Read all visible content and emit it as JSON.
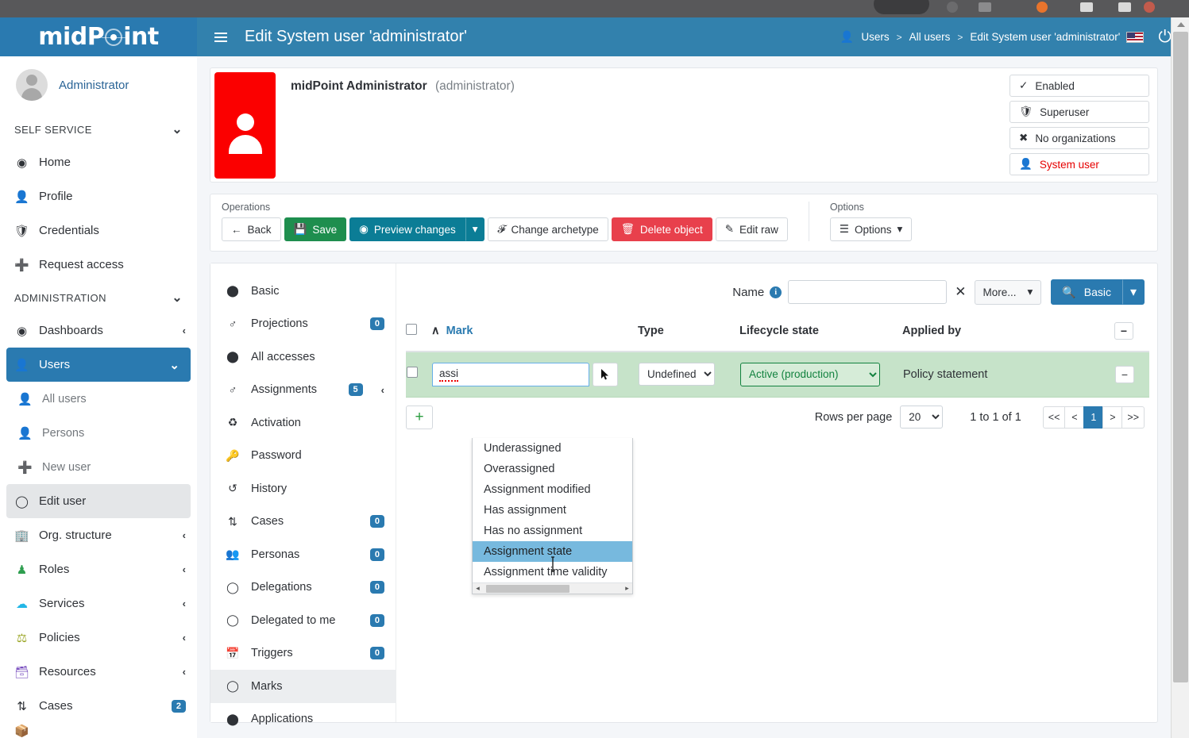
{
  "brand": {
    "name_part1": "mid",
    "name_part2": "P",
    "name_part3": "int"
  },
  "sidebar": {
    "user_name": "Administrator",
    "sections": [
      {
        "label": "SELF SERVICE",
        "chevron": "⌄"
      },
      {
        "label": "ADMINISTRATION",
        "chevron": "⌄"
      }
    ],
    "self_service_items": [
      {
        "label": "Home",
        "icon": "dashboard-icon"
      },
      {
        "label": "Profile",
        "icon": "person-icon"
      },
      {
        "label": "Credentials",
        "icon": "shield-icon"
      },
      {
        "label": "Request access",
        "icon": "plus-circle-icon"
      }
    ],
    "administration_items": [
      {
        "label": "Dashboards",
        "icon": "dashboard-icon",
        "chevron": "‹",
        "state": "normal"
      },
      {
        "label": "Users",
        "icon": "person-icon",
        "chevron": "⌄",
        "state": "active"
      },
      {
        "label": "All users",
        "icon": "person-icon",
        "state": "sub"
      },
      {
        "label": "Persons",
        "icon": "person-icon",
        "state": "sub"
      },
      {
        "label": "New user",
        "icon": "plus-circle-icon",
        "state": "sub"
      },
      {
        "label": "Edit user",
        "icon": "circle-icon",
        "state": "selected"
      },
      {
        "label": "Org. structure",
        "icon": "building-icon",
        "chevron": "‹",
        "state": "normal"
      },
      {
        "label": "Roles",
        "icon": "roles-icon",
        "chevron": "‹",
        "state": "normal"
      },
      {
        "label": "Services",
        "icon": "cloud-icon",
        "chevron": "‹",
        "state": "normal"
      },
      {
        "label": "Policies",
        "icon": "scales-icon",
        "chevron": "‹",
        "state": "normal"
      },
      {
        "label": "Resources",
        "icon": "database-icon",
        "chevron": "‹",
        "state": "normal"
      },
      {
        "label": "Cases",
        "icon": "cases-icon",
        "badge": "2",
        "state": "normal"
      }
    ]
  },
  "topbar": {
    "title": "Edit System user 'administrator'",
    "breadcrumb": [
      "Users",
      "All users",
      "Edit System user 'administrator'"
    ],
    "separator": ">",
    "flag": "us-flag-icon",
    "power": "⏻"
  },
  "identity": {
    "display_name": "midPoint Administrator",
    "alias": "(administrator)",
    "chips": [
      {
        "label": "Enabled",
        "icon": "check-icon",
        "style": "normal"
      },
      {
        "label": "Superuser",
        "icon": "shield-icon",
        "style": "normal"
      },
      {
        "label": "No organizations",
        "icon": "x-icon",
        "style": "normal"
      },
      {
        "label": "System user",
        "icon": "person-icon",
        "style": "red"
      }
    ]
  },
  "operations": {
    "label": "Operations",
    "buttons": [
      {
        "label": "Back",
        "icon": "arrow-left-icon",
        "style": "plain"
      },
      {
        "label": "Save",
        "icon": "save-icon",
        "style": "green"
      },
      {
        "label": "Preview changes",
        "icon": "eye-icon",
        "style": "teal",
        "caret": "▾"
      },
      {
        "label": "Change archetype",
        "icon": "archetype-icon",
        "style": "plain"
      },
      {
        "label": "Delete object",
        "icon": "trash-icon",
        "style": "red"
      },
      {
        "label": "Edit raw",
        "icon": "edit-icon",
        "style": "plain"
      }
    ],
    "options_label": "Options",
    "options_button": {
      "label": "Options",
      "icon": "menu-icon",
      "caret": "▾"
    }
  },
  "tabs": [
    {
      "label": "Basic",
      "icon": "filled-circle-icon",
      "badge": null,
      "state": "normal"
    },
    {
      "label": "Projections",
      "icon": "projection-icon",
      "badge": "0",
      "state": "normal"
    },
    {
      "label": "All accesses",
      "icon": "filled-circle-icon",
      "badge": null,
      "state": "normal"
    },
    {
      "label": "Assignments",
      "icon": "assignment-icon",
      "badge": "5",
      "chevron": "‹",
      "state": "normal"
    },
    {
      "label": "Activation",
      "icon": "recycle-icon",
      "badge": null,
      "state": "normal"
    },
    {
      "label": "Password",
      "icon": "key-icon",
      "badge": null,
      "state": "normal"
    },
    {
      "label": "History",
      "icon": "history-icon",
      "badge": null,
      "state": "normal"
    },
    {
      "label": "Cases",
      "icon": "cases-icon",
      "badge": "0",
      "state": "normal"
    },
    {
      "label": "Personas",
      "icon": "people-icon",
      "badge": "0",
      "state": "normal"
    },
    {
      "label": "Delegations",
      "icon": "circle-icon",
      "badge": "0",
      "state": "normal"
    },
    {
      "label": "Delegated to me",
      "icon": "circle-icon",
      "badge": "0",
      "state": "normal"
    },
    {
      "label": "Triggers",
      "icon": "calendar-check-icon",
      "badge": "0",
      "state": "normal"
    },
    {
      "label": "Marks",
      "icon": "circle-icon",
      "badge": null,
      "state": "selected"
    },
    {
      "label": "Applications",
      "icon": "filled-circle-icon",
      "badge": null,
      "state": "normal"
    }
  ],
  "search": {
    "name_label": "Name",
    "info_icon": "i",
    "value": "",
    "clear_icon": "✕",
    "more_label": "More...",
    "more_caret": "▾",
    "basic_label": "Basic",
    "basic_icon": "search-icon",
    "basic_caret": "▾"
  },
  "table": {
    "columns": [
      "Mark",
      "Type",
      "Lifecycle state",
      "Applied by"
    ],
    "sort_icon": "∧",
    "collapse_icon": "−",
    "rows": [
      {
        "mark_value": "assi",
        "type_value": "Undefined",
        "type_options": [
          "Undefined"
        ],
        "lifecycle_value": "Active (production)",
        "lifecycle_options": [
          "Active (production)"
        ],
        "applied_by": "Policy statement",
        "remove_icon": "−"
      }
    ],
    "add_icon": "+"
  },
  "autocomplete": {
    "items": [
      {
        "label": "Underassigned",
        "highlighted": false
      },
      {
        "label": "Overassigned",
        "highlighted": false
      },
      {
        "label": "Assignment modified",
        "highlighted": false
      },
      {
        "label": "Has assignment",
        "highlighted": false
      },
      {
        "label": "Has no assignment",
        "highlighted": false
      },
      {
        "label": "Assignment state",
        "highlighted": true
      },
      {
        "label": "Assignment time validity",
        "highlighted": false
      }
    ],
    "scroll_left": "◂",
    "scroll_right": "▸"
  },
  "pagination": {
    "rows_per_page_label": "Rows per page",
    "rows_per_page_value": "20",
    "rows_per_page_options": [
      "20"
    ],
    "range_text": "1 to 1 of 1",
    "buttons": [
      "<<",
      "<",
      "1",
      ">",
      ">>"
    ],
    "active_page": "1"
  },
  "colors": {
    "brand_blue": "#2a7ab0",
    "topbar_blue": "#3281ad",
    "green": "#1e8e4e",
    "teal": "#0b7d96",
    "red": "#e8404c",
    "row_green": "#c6e3c9",
    "highlight_blue": "#77b9de"
  }
}
